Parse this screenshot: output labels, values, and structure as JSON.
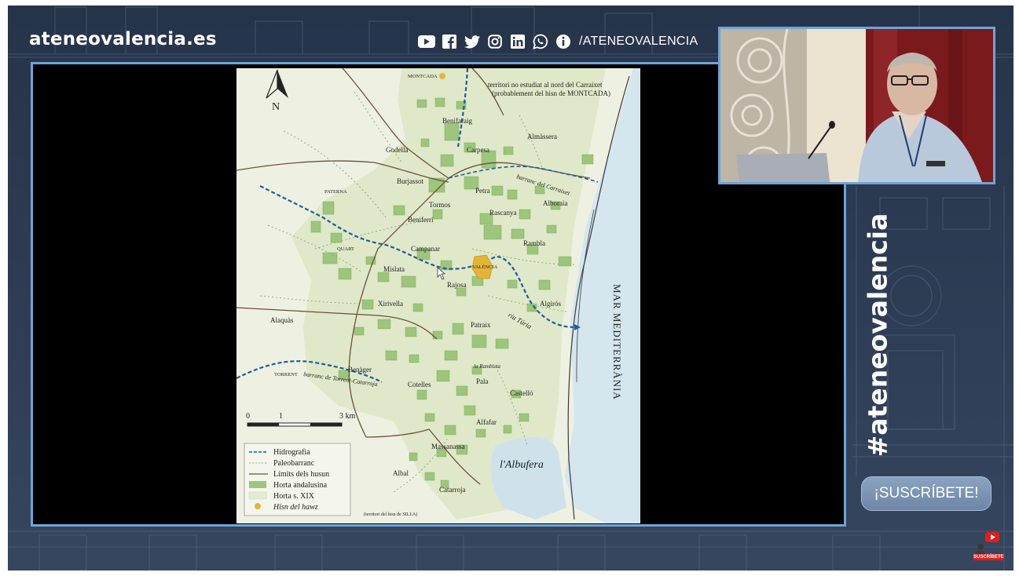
{
  "branding": {
    "site": "ateneovalencia.es",
    "social_handle": "/ATENEOVALENCIA",
    "hashtag": "#ateneovalencia",
    "social_icons": [
      "youtube-icon",
      "facebook-icon",
      "twitter-icon",
      "instagram-icon",
      "linkedin-icon",
      "whatsapp-icon",
      "info-icon"
    ]
  },
  "subscribe": {
    "label": "¡SUSCRÍBETE!",
    "yt_label": "SUSCRÍBETE"
  },
  "map": {
    "north": "N",
    "top_note_1": "territori no estudiat al nord del Carraixet",
    "top_note_2": "(probablement del hisn de MONTCADA)",
    "sea": "MAR MEDITERRÀNIA",
    "lake": "l'Albufera",
    "river_turia": "riu Túria",
    "barranc_carraixet": "barranc del Carraixet",
    "barranc_torrent": "barranc de Torrent-Catarroja",
    "bottom_note": "(territori del hisn de SILLA)",
    "places": {
      "montcada": "MONTCADA",
      "benifaraig": "Benifaraig",
      "godella": "Godella",
      "carpesa": "Carpesa",
      "almassera": "Almàssera",
      "burjassot": "Burjassot",
      "petra": "Petra",
      "alboraia": "Alboraia",
      "paterna": "PATERNA",
      "tormos": "Tormos",
      "rascanya": "Rascanya",
      "beniferri": "Beniferri",
      "rambla": "Rambla",
      "quart": "QUART",
      "campanar": "Campanar",
      "valencia": "VALÈNCIA",
      "mislata": "Mislata",
      "rajosa": "Rajosa",
      "algiros": "Algirós",
      "xirivella": "Xirivella",
      "alaquas": "Alaquàs",
      "patraix": "Patraix",
      "torrent": "TORRENT",
      "benager": "Benàger",
      "rambleta": "la Rambleta",
      "cotelles": "Cotelles",
      "pala": "Pala",
      "castello": "Castelló",
      "alfafar": "Alfafar",
      "massanassa": "Massanassa",
      "albal": "Albal",
      "catarroja": "Catarroja"
    },
    "scale": {
      "zero": "0",
      "one": "1",
      "three": "3 km"
    },
    "legend": [
      {
        "label": "Hidrografia",
        "swatch": "dash-blue"
      },
      {
        "label": "Paleobarranc",
        "swatch": "dot-green"
      },
      {
        "label": "Límits dels husun",
        "swatch": "line-brown"
      },
      {
        "label": "Horta andalusina",
        "swatch": "fill-green"
      },
      {
        "label": "Horta s. XIX",
        "swatch": "fill-lightgreen"
      },
      {
        "label": "Hisn del hawz",
        "swatch": "dot-yellow"
      }
    ]
  },
  "colors": {
    "frame_border": "#6fa4d6",
    "background": "#2b3a52",
    "map_paper": "#e6eed9",
    "horta_green": "#9dc67c",
    "sea": "#d5e6ef",
    "river": "#1f5c9a"
  }
}
